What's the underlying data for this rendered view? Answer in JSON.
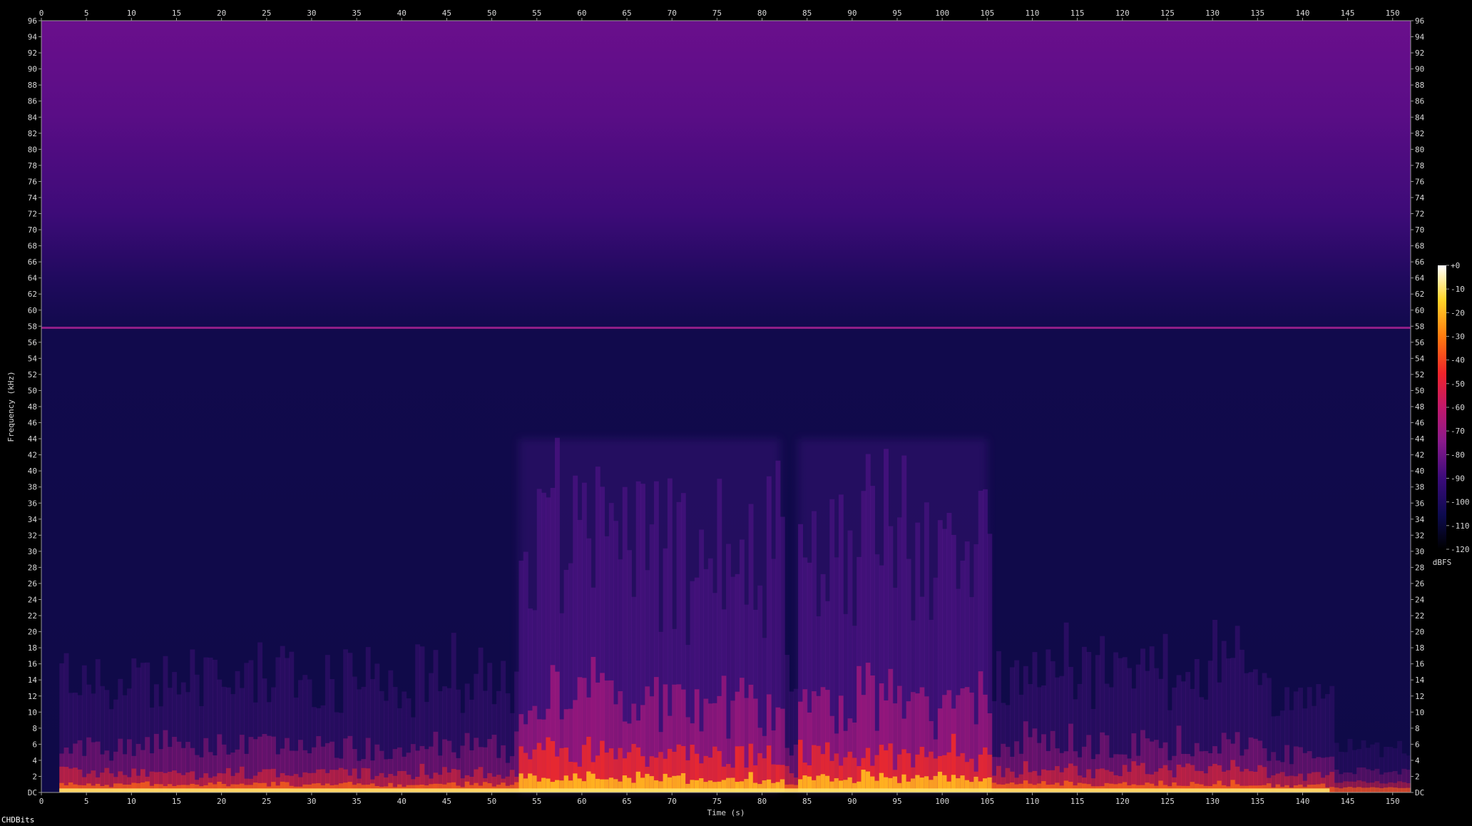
{
  "chart_data": {
    "type": "heatmap",
    "title": "",
    "xlabel": "Time (s)",
    "ylabel": "Frequency (kHz)",
    "xlim": [
      0,
      152
    ],
    "ylim": [
      0,
      96
    ],
    "x_ticks": [
      0,
      5,
      10,
      15,
      20,
      25,
      30,
      35,
      40,
      45,
      50,
      55,
      60,
      65,
      70,
      75,
      80,
      85,
      90,
      95,
      100,
      105,
      110,
      115,
      120,
      125,
      130,
      135,
      140,
      145,
      150
    ],
    "y_ticks": [
      "DC",
      "2",
      "4",
      "6",
      "8",
      "10",
      "12",
      "14",
      "16",
      "18",
      "20",
      "22",
      "24",
      "26",
      "28",
      "30",
      "32",
      "34",
      "36",
      "38",
      "40",
      "42",
      "44",
      "46",
      "48",
      "50",
      "52",
      "54",
      "56",
      "58",
      "60",
      "62",
      "64",
      "66",
      "68",
      "70",
      "72",
      "74",
      "76",
      "78",
      "80",
      "82",
      "84",
      "86",
      "88",
      "90",
      "92",
      "94",
      "96"
    ],
    "colorbar": {
      "label": "dBFS",
      "range": [
        -120,
        0
      ],
      "ticks": [
        "+0",
        "-10",
        "-20",
        "-30",
        "-40",
        "-50",
        "-60",
        "-70",
        "-80",
        "-90",
        "-100",
        "-110",
        "-120"
      ],
      "colors": [
        "#000000",
        "#0d0b4f",
        "#3b0b7a",
        "#8a1a8c",
        "#c2186b",
        "#f0242a",
        "#ff7b0f",
        "#ffd52a",
        "#ffffff"
      ]
    },
    "notable_features": {
      "tone_line_khz": 57.8,
      "loud_sections_s": [
        [
          53,
          82
        ],
        [
          84,
          105
        ]
      ],
      "quiet_tail_starts_s": 143,
      "audio_starts_s": 2
    },
    "grid": false
  },
  "caption": "CHDBits"
}
